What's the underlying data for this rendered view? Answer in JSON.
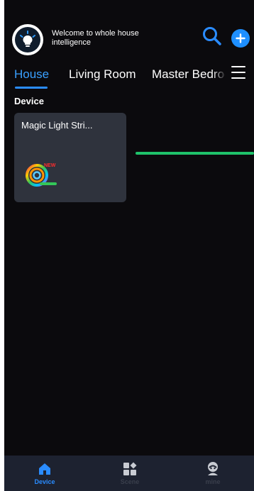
{
  "header": {
    "welcome_text": "Welcome to whole house intelligence",
    "avatar_icon": "lightbulb-icon",
    "search_icon": "search-icon",
    "add_icon": "plus-icon"
  },
  "tabs": [
    {
      "label": "House",
      "active": true
    },
    {
      "label": "Living Room",
      "active": false
    },
    {
      "label": "Master Bedroom",
      "active": false
    }
  ],
  "menu_icon": "hamburger-menu-icon",
  "section": {
    "title": "Device"
  },
  "devices": [
    {
      "name": "Magic Light Stri...",
      "icon": "led-strip-icon",
      "badge": "NEW"
    }
  ],
  "bottom_nav": [
    {
      "label": "Device",
      "icon": "home-icon",
      "active": true
    },
    {
      "label": "Scene",
      "icon": "grid-icon",
      "active": false
    },
    {
      "label": "mine",
      "icon": "user-icon",
      "active": false
    }
  ],
  "colors": {
    "background": "#0b0a0d",
    "accent": "#2a8cff",
    "card": "#2f333d",
    "nav": "#1d2230",
    "green_line": "#1fc26a"
  }
}
